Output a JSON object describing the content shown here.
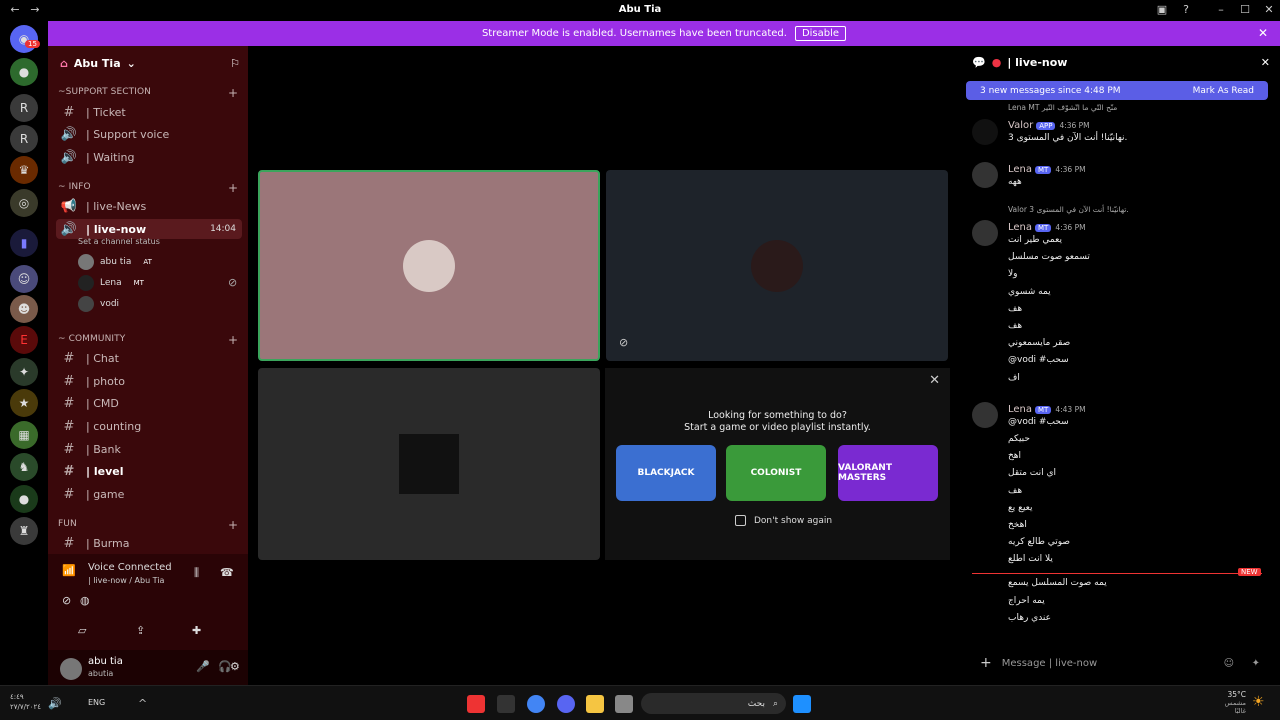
{
  "window": {
    "title": "Abu Tia"
  },
  "banner": {
    "text": "Streamer Mode is enabled. Usernames have been truncated.",
    "button": "Disable"
  },
  "server": {
    "name": "Abu Tia"
  },
  "server_badge": "15",
  "categories": [
    {
      "label": "~SUPPORT SECTION",
      "channels": [
        "| Ticket",
        "| Support voice",
        "| Waiting"
      ]
    },
    {
      "label": "~ INFO",
      "channels": [
        "| live-News",
        "| live-now"
      ]
    },
    {
      "label": "~ COMMUNITY",
      "channels": [
        "| Chat",
        "| photo",
        "| CMD",
        "| counting",
        "| Bank",
        "| level",
        "| game"
      ]
    },
    {
      "label": "FUN",
      "channels": [
        "| Burma"
      ]
    }
  ],
  "active_channel": {
    "name": "| live-now",
    "time": "14:04",
    "status": "Set a channel status"
  },
  "voice_users": [
    {
      "name": "abu tia",
      "tag": "AT"
    },
    {
      "name": "Lena",
      "tag": "MT"
    },
    {
      "name": "vodi"
    }
  ],
  "voice_panel": {
    "title": "Voice Connected",
    "subtitle": "| live-now / Abu Tia"
  },
  "user": {
    "name": "abu tia",
    "status": "abutia"
  },
  "activity": {
    "line1": "Looking for something to do?",
    "line2": "Start a game or video playlist instantly.",
    "games": [
      "BLACKJACK",
      "COLONIST",
      "VALORANT MASTERS"
    ],
    "checkbox": "Don't show again"
  },
  "chat": {
    "channel": "| live-now",
    "new_messages": "3 new messages since 4:48 PM",
    "mark_read": "Mark As Read",
    "messages": [
      {
        "reply": "Lena MT",
        "reply_text": "منّح التّي ما اتّشوّف التّير",
        "author": "Valor",
        "app": "APP",
        "time": "4:36 PM",
        "lines": [
          "نهانيّنا! أنت الآن في المستوى 3."
        ]
      },
      {
        "author": "Lena",
        "tag": "MT",
        "time": "4:36 PM",
        "lines": [
          "ههه"
        ]
      },
      {
        "reply": "Valor",
        "reply_text": "تهانيّنا! أنت الآن في المستوى 3.",
        "author": "Lena",
        "tag": "MT",
        "time": "4:36 PM",
        "lines": [
          "يعمي طير انت",
          "تسمعو صوت مسلسل",
          "ولا",
          "يمه شسوي",
          "هف",
          "هف",
          "صقر مايسمعوني",
          "@vodi #سحب",
          "اف"
        ]
      },
      {
        "author": "Lena",
        "tag": "MT",
        "time": "4:43 PM",
        "lines": [
          "@vodi #سحب",
          "حبيكم",
          "اهخ",
          "اي انت متقل",
          "هف",
          "يعيع يع",
          "اهخخ",
          "صوتي طالع كريه",
          "يلا انت اطلع"
        ]
      }
    ],
    "after_new": [
      "يمه صوت المسلسل يسمع",
      "يمه احراج",
      "عندي رهاب"
    ],
    "new_label": "NEW",
    "input_placeholder": "Message | live-now"
  },
  "taskbar": {
    "lang": "ENG",
    "search": "بحث",
    "temp": "35°C",
    "weather": "مشمس غالبًا",
    "time_line1": "٤:٤٩",
    "time_line2": "٢٧/٧/٢٠٢٤"
  }
}
